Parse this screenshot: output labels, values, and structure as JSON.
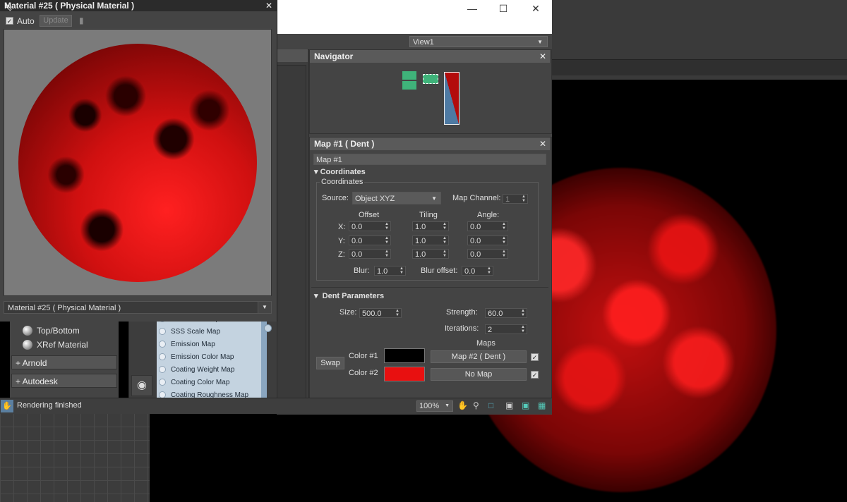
{
  "material_window": {
    "title": "Material #25  ( Physical Material )",
    "auto_label": "Auto",
    "update_label": "Update",
    "material_select": "Material #25  ( Physical Material )"
  },
  "editor": {
    "view_select": "View1"
  },
  "navigator": {
    "title": "Navigator"
  },
  "map_panel": {
    "title": "Map #1  ( Dent )",
    "name_field": "Map #1",
    "coordinates_rollout": "Coordinates",
    "coordinates_group": "Coordinates",
    "source_label": "Source:",
    "source_value": "Object XYZ",
    "map_channel_label": "Map Channel:",
    "map_channel_value": "1",
    "headers": {
      "offset": "Offset",
      "tiling": "Tiling",
      "angle": "Angle:"
    },
    "rows": [
      {
        "axis": "X:",
        "offset": "0.0",
        "tiling": "1.0",
        "angle": "0.0"
      },
      {
        "axis": "Y:",
        "offset": "0.0",
        "tiling": "1.0",
        "angle": "0.0"
      },
      {
        "axis": "Z:",
        "offset": "0.0",
        "tiling": "1.0",
        "angle": "0.0"
      }
    ],
    "blur_label": "Blur:",
    "blur_value": "1.0",
    "blur_offset_label": "Blur offset:",
    "blur_offset_value": "0.0",
    "dent_rollout": "Dent Parameters",
    "size_label": "Size:",
    "size_value": "500.0",
    "strength_label": "Strength:",
    "strength_value": "60.0",
    "iterations_label": "Iterations:",
    "iterations_value": "2",
    "maps_label": "Maps",
    "swap_label": "Swap",
    "color1_label": "Color #1",
    "color2_label": "Color #2",
    "color1": "#000000",
    "color2": "#e81010",
    "map1_button": "Map #2  ( Dent )",
    "map2_button": "No Map"
  },
  "left_list": {
    "items": [
      "Top/Bottom",
      "XRef Material"
    ],
    "groups": [
      "+ Arnold",
      "+ Autodesk"
    ]
  },
  "slots": [
    "SSS Color Map",
    "SSS Scale Map",
    "Emission Map",
    "Emission Color Map",
    "Coating Weight Map",
    "Coating Color Map",
    "Coating Roughness Map"
  ],
  "status": {
    "text": "Rendering finished",
    "zoom": "100%"
  }
}
